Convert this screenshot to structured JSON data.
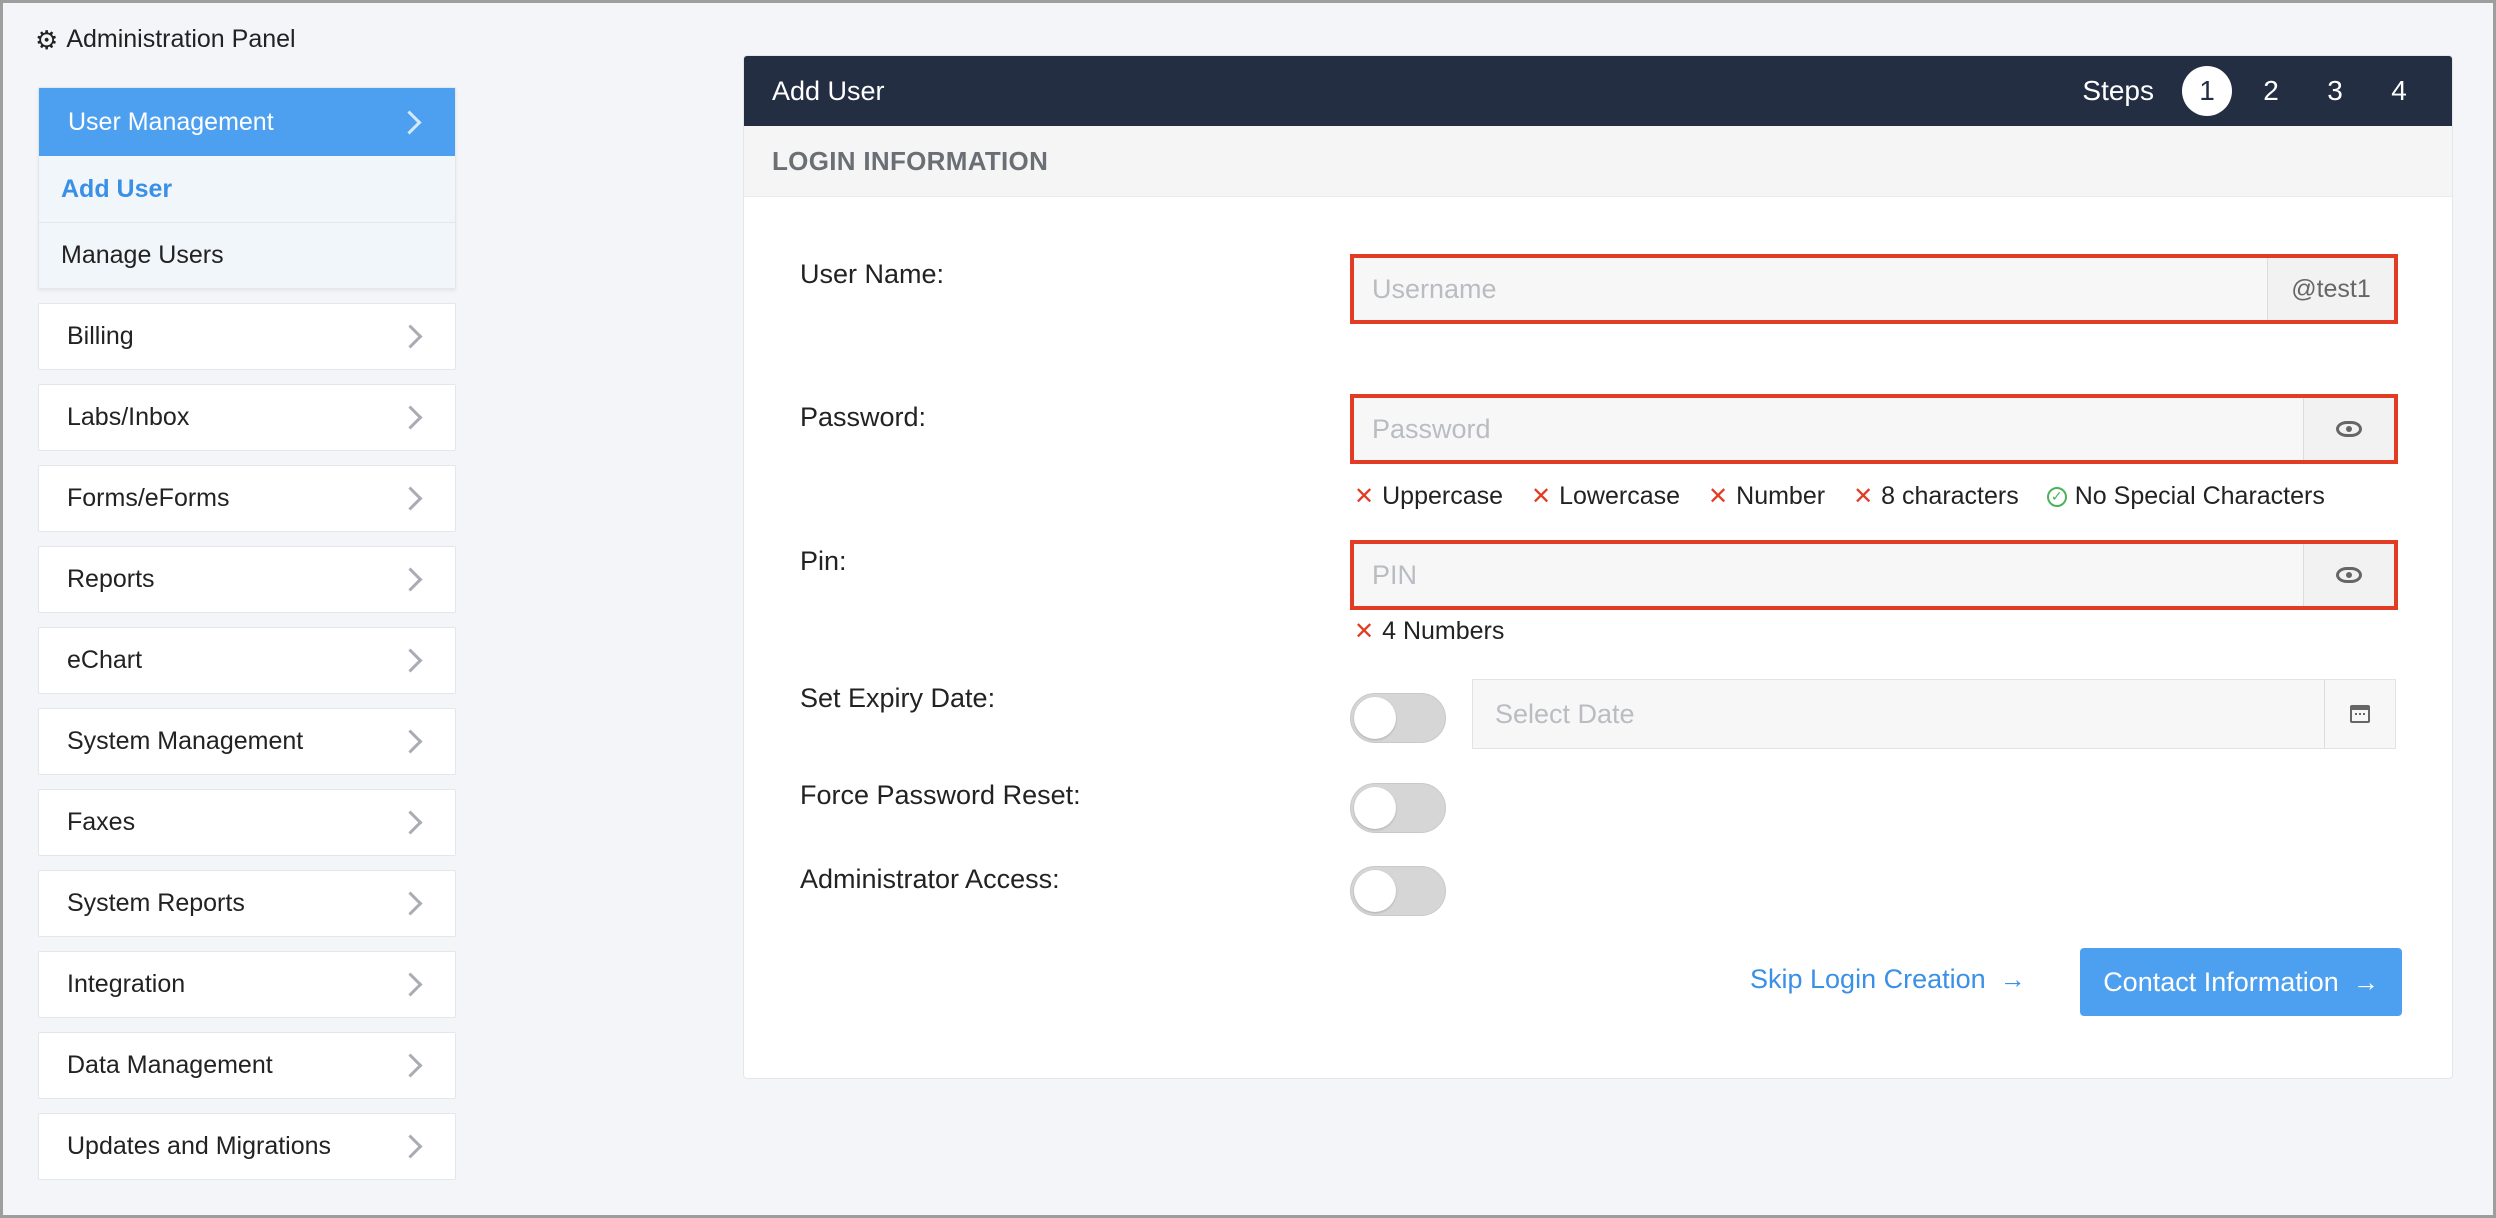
{
  "panel": {
    "title": "Administration Panel",
    "icon": "gear-icon"
  },
  "sidebar": {
    "active": {
      "label": "User Management",
      "subitems": [
        "Add User",
        "Manage Users"
      ]
    },
    "items": [
      "Billing",
      "Labs/Inbox",
      "Forms/eForms",
      "Reports",
      "eChart",
      "System Management",
      "Faxes",
      "System Reports",
      "Integration",
      "Data Management",
      "Updates and Migrations"
    ]
  },
  "card": {
    "title": "Add User",
    "steps_label": "Steps",
    "steps": [
      "1",
      "2",
      "3",
      "4"
    ],
    "current_step": "1",
    "section": "LOGIN INFORMATION"
  },
  "form": {
    "username": {
      "label": "User Name:",
      "placeholder": "Username",
      "value": "",
      "suffix": "@test1"
    },
    "password": {
      "label": "Password:",
      "placeholder": "Password",
      "value": ""
    },
    "password_rules": [
      {
        "text": "Uppercase",
        "met": false
      },
      {
        "text": "Lowercase",
        "met": false
      },
      {
        "text": "Number",
        "met": false
      },
      {
        "text": "8 characters",
        "met": false
      },
      {
        "text": "No Special Characters",
        "met": true
      }
    ],
    "pin": {
      "label": "Pin:",
      "placeholder": "PIN",
      "value": ""
    },
    "pin_rule": {
      "text": "4 Numbers",
      "met": false
    },
    "expiry": {
      "label": "Set Expiry Date:",
      "placeholder": "Select Date",
      "enabled": false
    },
    "force_reset": {
      "label": "Force Password Reset:",
      "enabled": false
    },
    "admin_access": {
      "label": "Administrator Access:",
      "enabled": false
    }
  },
  "actions": {
    "skip": "Skip Login Creation",
    "next": "Contact Information"
  },
  "colors": {
    "header": "#232e42",
    "accent": "#4da0f0",
    "error": "#e23d24",
    "success": "#4db35a"
  }
}
